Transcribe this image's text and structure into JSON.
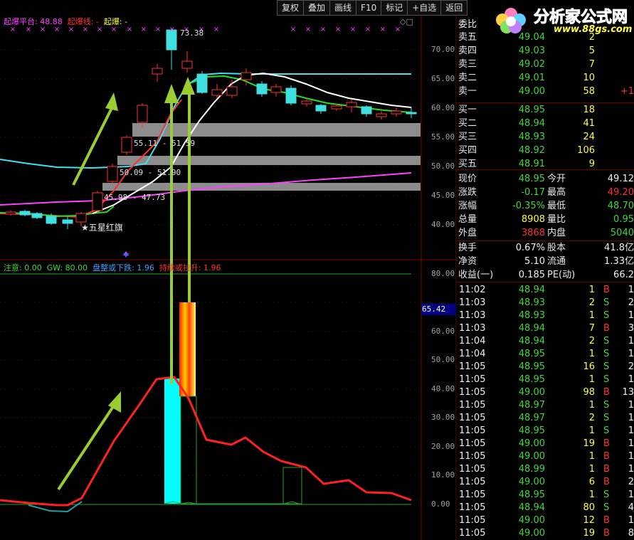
{
  "toolbar": {
    "buttons": [
      "复权",
      "叠加",
      "画线",
      "F10",
      "标记",
      "+自选",
      "返回"
    ]
  },
  "logo": {
    "brand": "分析家公式网",
    "url": "www.88gs.com"
  },
  "main_chart": {
    "legend": [
      {
        "text": "起爆平台: 48.88",
        "color": "#ff40ff"
      },
      {
        "text": "起爆线: -",
        "color": "#ff3030"
      },
      {
        "text": "起爆: -",
        "color": "#ffff40"
      }
    ],
    "peak_label": "73.38",
    "range_labels": [
      "55.11 - 51.59",
      "50.09 - 51.90",
      "45.98 - 47.73"
    ],
    "star_label": "★五星红旗",
    "y_ticks": [
      "70.00",
      "65.00",
      "60.00",
      "55.00",
      "50.00",
      "45.00",
      "40.00"
    ]
  },
  "sub_chart": {
    "legend": [
      {
        "text": "注意: 0.00",
        "color": "#3cd93c"
      },
      {
        "text": "GW: 80.00",
        "color": "#3cd93c"
      },
      {
        "text": "盘整或下跌: 1.96",
        "color": "#40a0ff"
      },
      {
        "text": "持续或拉升: 1.96",
        "color": "#ff3030"
      }
    ],
    "y_ticks": [
      "80.00",
      "70.00",
      "60.00",
      "50.00",
      "40.00",
      "30.00",
      "20.00",
      "10.00",
      "0.00"
    ],
    "cursor_value": "65.42"
  },
  "panel": {
    "weibi_label": "委比",
    "asks": [
      {
        "label": "卖五",
        "price": "49.04",
        "vol": "2"
      },
      {
        "label": "卖四",
        "price": "49.03",
        "vol": "5"
      },
      {
        "label": "卖三",
        "price": "49.02",
        "vol": "7"
      },
      {
        "label": "卖二",
        "price": "49.01",
        "vol": "10"
      },
      {
        "label": "卖一",
        "price": "49.00",
        "vol": "58",
        "extra": "+1"
      }
    ],
    "bids": [
      {
        "label": "买一",
        "price": "48.95",
        "vol": "18"
      },
      {
        "label": "买二",
        "price": "48.94",
        "vol": "41"
      },
      {
        "label": "买三",
        "price": "48.93",
        "vol": "24"
      },
      {
        "label": "买四",
        "price": "48.92",
        "vol": "106"
      },
      {
        "label": "买五",
        "price": "48.91",
        "vol": "9"
      }
    ],
    "quote": [
      {
        "l1": "现价",
        "v1": "48.95",
        "c1": "green",
        "l2": "今开",
        "v2": "49.12",
        "c2": "white"
      },
      {
        "l1": "涨跌",
        "v1": "-0.17",
        "c1": "green",
        "l2": "最高",
        "v2": "49.20",
        "c2": "red"
      },
      {
        "l1": "涨幅",
        "v1": "-0.35%",
        "c1": "green",
        "l2": "最低",
        "v2": "48.70",
        "c2": "green"
      },
      {
        "l1": "总量",
        "v1": "8908",
        "c1": "yellow",
        "l2": "量比",
        "v2": "0.95",
        "c2": "green"
      },
      {
        "l1": "外盘",
        "v1": "3868",
        "c1": "red",
        "l2": "内盘",
        "v2": "5040",
        "c2": "green"
      }
    ],
    "fundamentals": [
      {
        "l1": "换手",
        "v1": "0.67%",
        "l2": "股本",
        "v2": "41.8亿"
      },
      {
        "l1": "净资",
        "v1": "5.10",
        "l2": "流通",
        "v2": "1.33亿"
      },
      {
        "l1": "收益(一)",
        "v1": "0.185",
        "l2": "PE(动)",
        "v2": "66.2"
      }
    ],
    "ticks": [
      {
        "time": "11:02",
        "price": "48.94",
        "vol": "1",
        "side": "B",
        "n": "1"
      },
      {
        "time": "11:03",
        "price": "48.93",
        "vol": "2",
        "side": "S",
        "n": "2"
      },
      {
        "time": "11:03",
        "price": "48.93",
        "vol": "1",
        "side": "S",
        "n": "1"
      },
      {
        "time": "11:03",
        "price": "48.94",
        "vol": "7",
        "side": "B",
        "n": "3"
      },
      {
        "time": "11:04",
        "price": "48.94",
        "vol": "2",
        "side": "S",
        "n": "1"
      },
      {
        "time": "11:04",
        "price": "48.95",
        "vol": "1",
        "side": "S",
        "n": "1"
      },
      {
        "time": "11:05",
        "price": "48.95",
        "vol": "16",
        "side": "S",
        "n": "2"
      },
      {
        "time": "11:05",
        "price": "48.95",
        "vol": "1",
        "side": "S",
        "n": "1"
      },
      {
        "time": "11:05",
        "price": "49.00",
        "vol": "98",
        "side": "B",
        "n": "13"
      },
      {
        "time": "11:05",
        "price": "48.97",
        "vol": "1",
        "side": "S",
        "n": "1"
      },
      {
        "time": "11:05",
        "price": "48.97",
        "vol": "2",
        "side": "S",
        "n": "1"
      },
      {
        "time": "11:05",
        "price": "48.95",
        "vol": "1",
        "side": "S",
        "n": "1"
      },
      {
        "time": "11:05",
        "price": "49.00",
        "vol": "19",
        "side": "B",
        "n": "1"
      },
      {
        "time": "11:05",
        "price": "49.00",
        "vol": "1",
        "side": "B",
        "n": "1"
      },
      {
        "time": "11:05",
        "price": "48.99",
        "vol": "1",
        "side": "B",
        "n": "1"
      },
      {
        "time": "11:05",
        "price": "49.00",
        "vol": "6",
        "side": "B",
        "n": "2"
      },
      {
        "time": "11:05",
        "price": "48.95",
        "vol": "1",
        "side": "S",
        "n": "1"
      },
      {
        "time": "11:05",
        "price": "48.94",
        "vol": "80",
        "side": "S",
        "n": "4"
      },
      {
        "time": "11:05",
        "price": "49.00",
        "vol": "12",
        "side": "B",
        "n": "1"
      },
      {
        "time": "11:05",
        "price": "49.00",
        "vol": "19",
        "side": "B",
        "n": "8"
      }
    ]
  },
  "colors": {
    "up": "#ff3030",
    "down": "#40e0e0",
    "ma_white": "#ffffff",
    "ma_green": "#20e020",
    "ma_cyan": "#40e0f0",
    "ma_magenta": "#ff40ff",
    "arrow": "#9acd32",
    "platform": "#909090"
  }
}
